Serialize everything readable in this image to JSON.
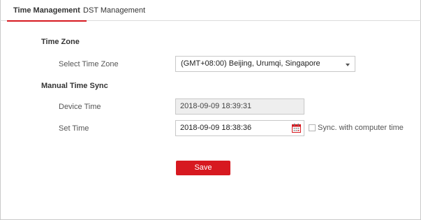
{
  "tabs": [
    {
      "label": "Time Management"
    },
    {
      "label": "DST Management"
    }
  ],
  "time_zone": {
    "section_title": "Time Zone",
    "select_label": "Select Time Zone",
    "selected_value": "(GMT+08:00) Beijing, Urumqi, Singapore"
  },
  "manual_sync": {
    "section_title": "Manual Time Sync",
    "device_time_label": "Device Time",
    "device_time_value": "2018-09-09 18:39:31",
    "set_time_label": "Set Time",
    "set_time_value": "2018-09-09 18:38:36",
    "sync_checkbox_label": "Sync. with computer time",
    "sync_checked": false
  },
  "actions": {
    "save_label": "Save"
  },
  "colors": {
    "accent": "#d71920",
    "calendar_icon": "#d71920"
  }
}
